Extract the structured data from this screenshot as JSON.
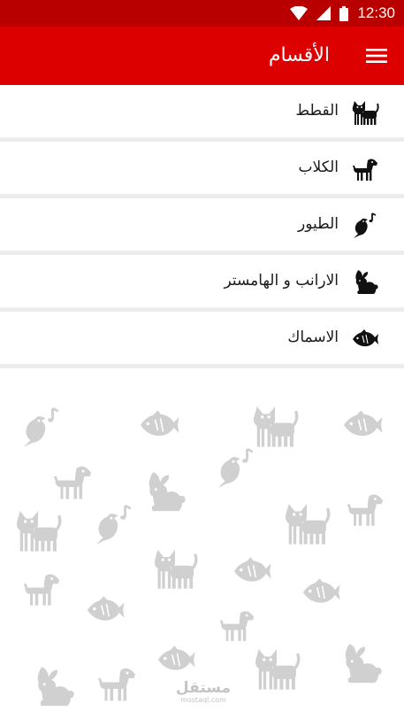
{
  "status_bar": {
    "time": "12:30"
  },
  "app_bar": {
    "title": "الأقسام"
  },
  "categories": [
    {
      "label": "القطط",
      "icon": "cat-icon"
    },
    {
      "label": "الكلاب",
      "icon": "dog-icon"
    },
    {
      "label": "الطيور",
      "icon": "bird-icon"
    },
    {
      "label": "الارانب و الهامستر",
      "icon": "rabbit-icon"
    },
    {
      "label": "الاسماك",
      "icon": "fish-icon"
    }
  ],
  "watermark": {
    "logo": "مستقل",
    "url": "mostaql.com"
  },
  "colors": {
    "status_bar": "#b80000",
    "app_bar": "#dd0000",
    "divider": "#ececec",
    "icon": "#111111",
    "pattern_icon": "#d0d0d0"
  }
}
